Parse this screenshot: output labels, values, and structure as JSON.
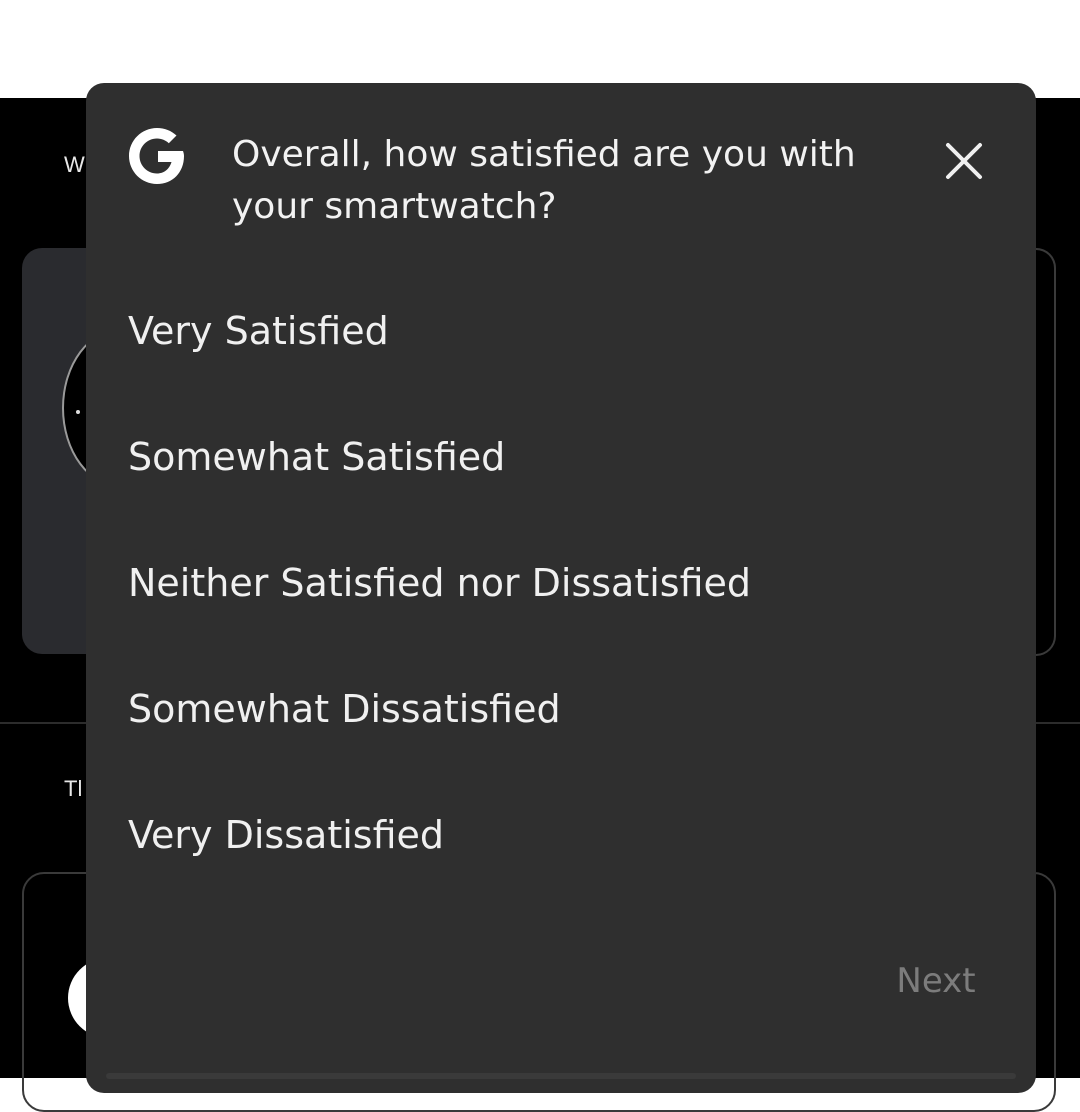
{
  "background": {
    "heading_1": "W",
    "heading_2": "Tl"
  },
  "survey": {
    "logo": "google-g-icon",
    "question": "Overall, how satisfied are you with your smartwatch?",
    "close_icon": "close-icon",
    "options": [
      "Very Satisfied",
      "Somewhat Satisfied",
      "Neither Satisfied nor Dissatisfied",
      "Somewhat Dissatisfied",
      "Very Dissatisfied"
    ],
    "next_label": "Next"
  },
  "colors": {
    "page_top": "#ffffff",
    "app_background": "#000000",
    "dialog_background": "#2f2f2f",
    "text_primary": "#f0f0f0",
    "next_disabled": "#7c7c7c"
  }
}
